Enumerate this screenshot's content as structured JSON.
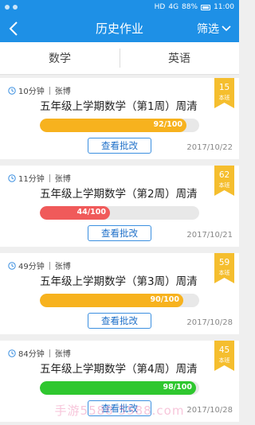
{
  "status_bar": {
    "battery": "88%",
    "time": "11:00",
    "network": "4G",
    "hd": "HD"
  },
  "header": {
    "title": "历史作业",
    "filter_label": "筛选"
  },
  "tabs": [
    {
      "label": "数学"
    },
    {
      "label": "英语"
    }
  ],
  "assignments": [
    {
      "duration": "10分钟",
      "teacher": "张博",
      "title": "五年级上学期数学（第1周）周清",
      "score": 92,
      "score_text": "92/100",
      "bar_color": "#f7b21e",
      "rank": "15",
      "rank_label": "本班",
      "button": "查看批改",
      "date": "2017/10/22"
    },
    {
      "duration": "11分钟",
      "teacher": "张博",
      "title": "五年级上学期数学（第2周）周清",
      "score": 44,
      "score_text": "44/100",
      "bar_color": "#f05a5a",
      "rank": "62",
      "rank_label": "本班",
      "button": "查看批改",
      "date": "2017/10/21"
    },
    {
      "duration": "49分钟",
      "teacher": "张博",
      "title": "五年级上学期数学（第3周）周清",
      "score": 90,
      "score_text": "90/100",
      "bar_color": "#f7b21e",
      "rank": "59",
      "rank_label": "本班",
      "button": "查看批改",
      "date": "2017/10/28"
    },
    {
      "duration": "84分钟",
      "teacher": "张博",
      "title": "五年级上学期数学（第4周）周清",
      "score": 98,
      "score_text": "98/100",
      "bar_color": "#2fc72f",
      "rank": "45",
      "rank_label": "本班",
      "button": "查看批改",
      "date": "2017/10/28"
    }
  ],
  "watermark": "手游5588 5588.com"
}
